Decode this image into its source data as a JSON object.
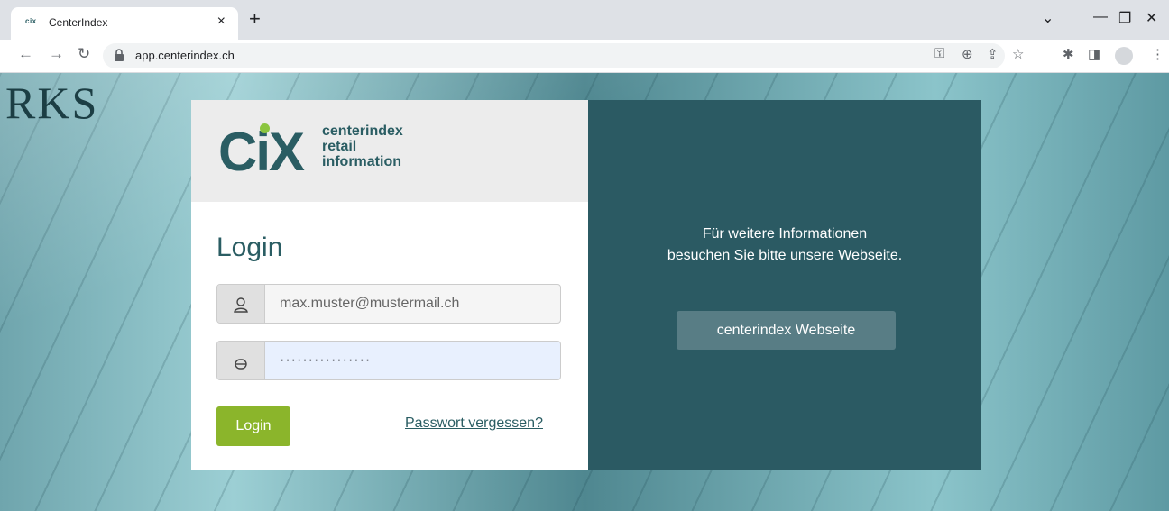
{
  "browser": {
    "tab_favicon": "cix",
    "tab_title": "CenterIndex",
    "tab_close": "×",
    "new_tab": "+",
    "url": "app.centerindex.ch"
  },
  "background": {
    "text": "RKS"
  },
  "logo": {
    "mark": "CiX",
    "line1": "centerindex",
    "line2": "retail",
    "line3": "information"
  },
  "login": {
    "title": "Login",
    "username_value": "max.muster@mustermail.ch",
    "password_value": "················",
    "button_label": "Login",
    "forgot_link": "Passwort vergessen?"
  },
  "info": {
    "line1": "Für weitere Informationen",
    "line2": "besuchen Sie bitte unsere Webseite.",
    "button_label": "centerindex Webseite"
  },
  "colors": {
    "brand_teal": "#2a5d63",
    "accent_green": "#8bb52b"
  }
}
